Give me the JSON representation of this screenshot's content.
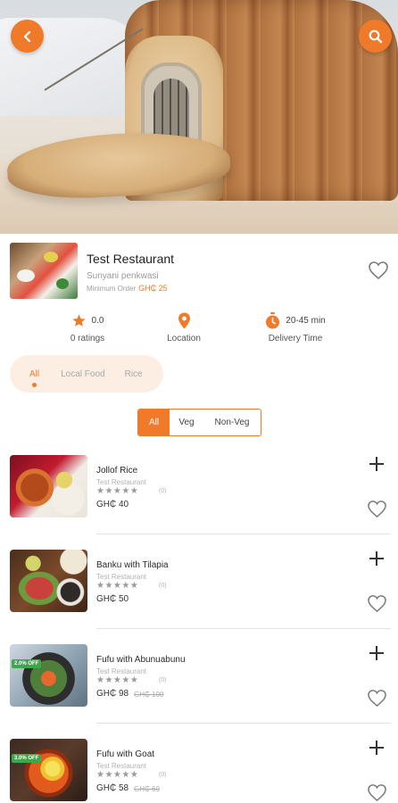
{
  "colors": {
    "accent": "#ef7a2a",
    "discount_badge": "#3aa94a"
  },
  "header": {
    "back_icon": "chevron-left-icon",
    "search_icon": "search-icon"
  },
  "restaurant": {
    "name": "Test Restaurant",
    "location": "Sunyani penkwasi",
    "minimum_order_label": "Minimum Order",
    "minimum_order_value": "GH₵ 25"
  },
  "stats": {
    "rating_value": "0.0",
    "rating_label": "0 ratings",
    "location_label": "Location",
    "delivery_value": "20-45 min",
    "delivery_label": "Delivery Time"
  },
  "categories": [
    "All",
    "Local Food",
    "Rice"
  ],
  "veg_filter": [
    "All",
    "Veg",
    "Non-Veg"
  ],
  "menu": [
    {
      "name": "Jollof Rice",
      "restaurant": "Test Restaurant",
      "stars": "★★★★★",
      "rating_count": "(0)",
      "price": "GH₵ 40",
      "old_price": "",
      "discount": ""
    },
    {
      "name": "Banku with Tilapia",
      "restaurant": "Test Restaurant",
      "stars": "★★★★★",
      "rating_count": "(0)",
      "price": "GH₵ 50",
      "old_price": "",
      "discount": ""
    },
    {
      "name": "Fufu with Abunuabunu",
      "restaurant": "Test Restaurant",
      "stars": "★★★★★",
      "rating_count": "(0)",
      "price": "GH₵ 98",
      "old_price": "GH₵ 100",
      "discount": "2.0% OFF"
    },
    {
      "name": "Fufu with Goat",
      "restaurant": "Test Restaurant",
      "stars": "★★★★★",
      "rating_count": "(0)",
      "price": "GH₵ 58",
      "old_price": "GH₵ 60",
      "discount": "3.0% OFF"
    }
  ]
}
